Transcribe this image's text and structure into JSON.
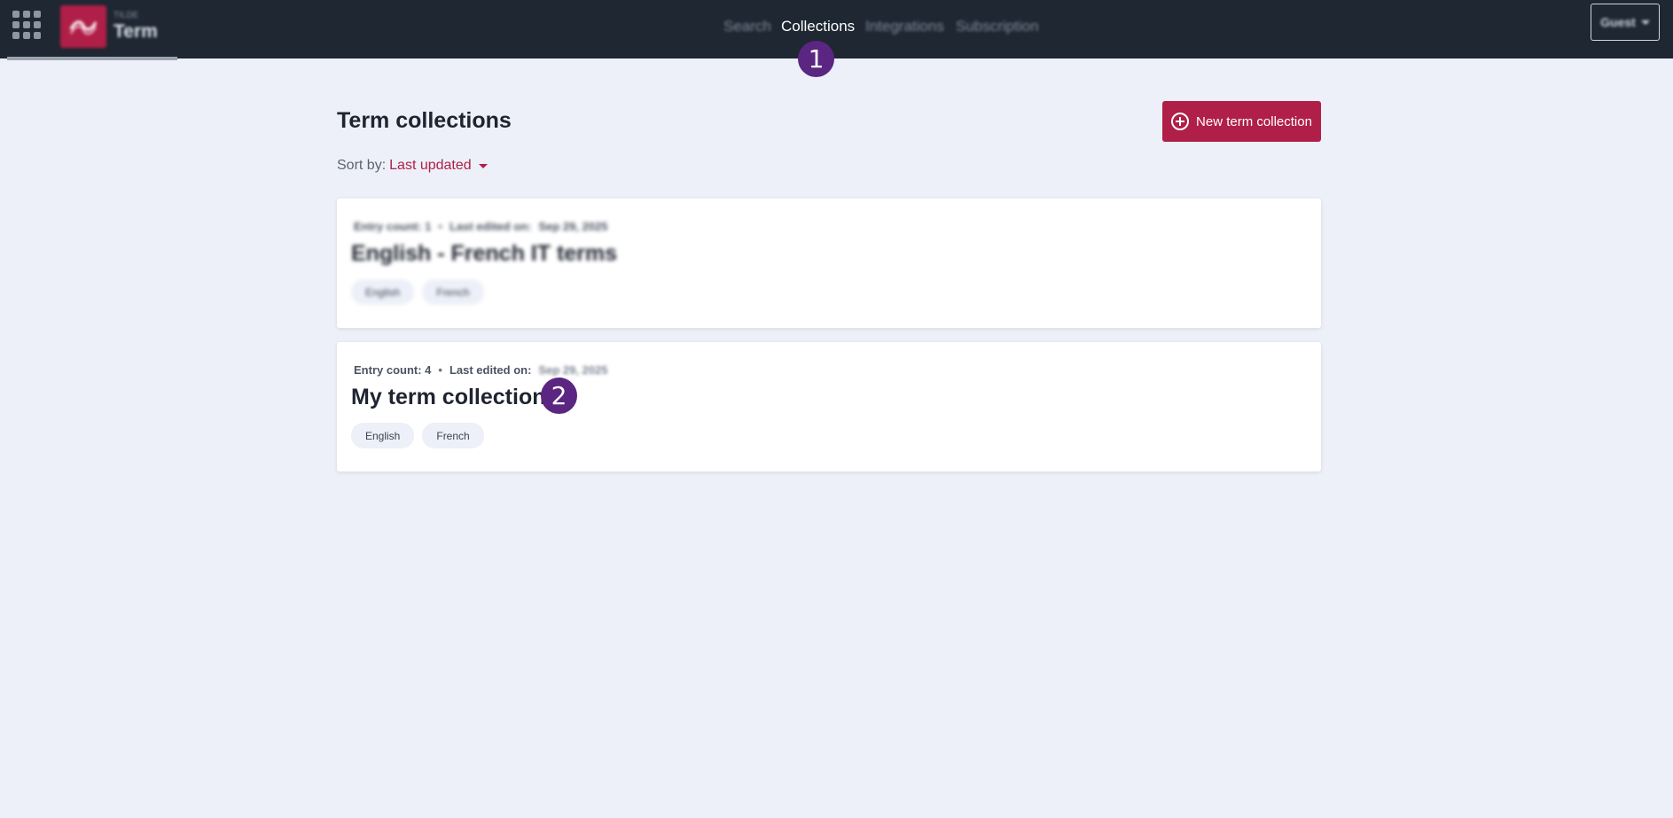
{
  "header": {
    "brand_small": "TILDE",
    "brand_name": "Term",
    "nav": [
      {
        "label": "Search"
      },
      {
        "label": "Collections"
      },
      {
        "label": "Integrations"
      },
      {
        "label": "Subscription"
      }
    ],
    "account_label": "Guest"
  },
  "markers": [
    "1",
    "2"
  ],
  "main": {
    "title": "Term collections",
    "new_button_label": "New term collection",
    "sort_label": "Sort by:",
    "sort_value": "Last updated"
  },
  "collections": [
    {
      "entry_count": "Entry count: 1",
      "last_edited_label": "Last edited on:",
      "last_edited_date": "Sep 29, 2025",
      "title": "English - French IT terms",
      "tags": [
        "English",
        "French"
      ]
    },
    {
      "entry_count": "Entry count: 4",
      "last_edited_label": "Last edited on:",
      "last_edited_date": "Sep 29, 2025",
      "title": "My term collection",
      "tags": [
        "English",
        "French"
      ]
    }
  ],
  "colors": {
    "topbar": "#1e2732",
    "accent": "#b01f48",
    "background": "#edf0f8",
    "marker": "#5b2582"
  }
}
